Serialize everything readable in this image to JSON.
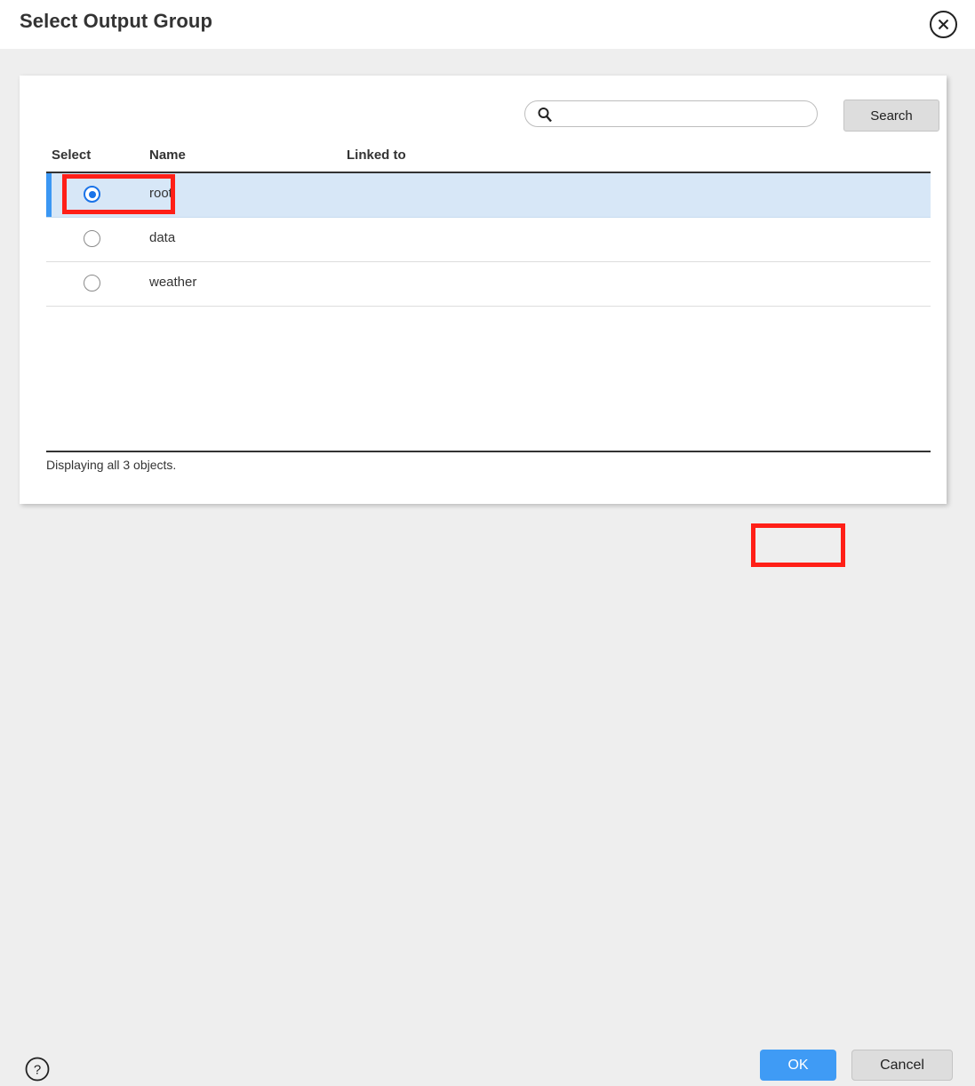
{
  "dialog": {
    "title": "Select Output Group",
    "close_icon": "close-circle-icon"
  },
  "search": {
    "value": "",
    "placeholder": "",
    "icon": "search-icon",
    "button_label": "Search"
  },
  "table": {
    "columns": [
      "Select",
      "Name",
      "Linked to"
    ],
    "rows": [
      {
        "selected": true,
        "name": "root",
        "linked_to": ""
      },
      {
        "selected": false,
        "name": "data",
        "linked_to": ""
      },
      {
        "selected": false,
        "name": "weather",
        "linked_to": ""
      }
    ],
    "status": "Displaying all 3 objects."
  },
  "footer": {
    "help_icon": "help-circle-icon",
    "ok_label": "OK",
    "cancel_label": "Cancel"
  },
  "colors": {
    "accent_blue": "#3b97f3",
    "row_highlight": "#d7e7f7",
    "primary_button": "#3f9bf5",
    "annotation_red": "#ff1f17",
    "background": "#eeeeee"
  }
}
